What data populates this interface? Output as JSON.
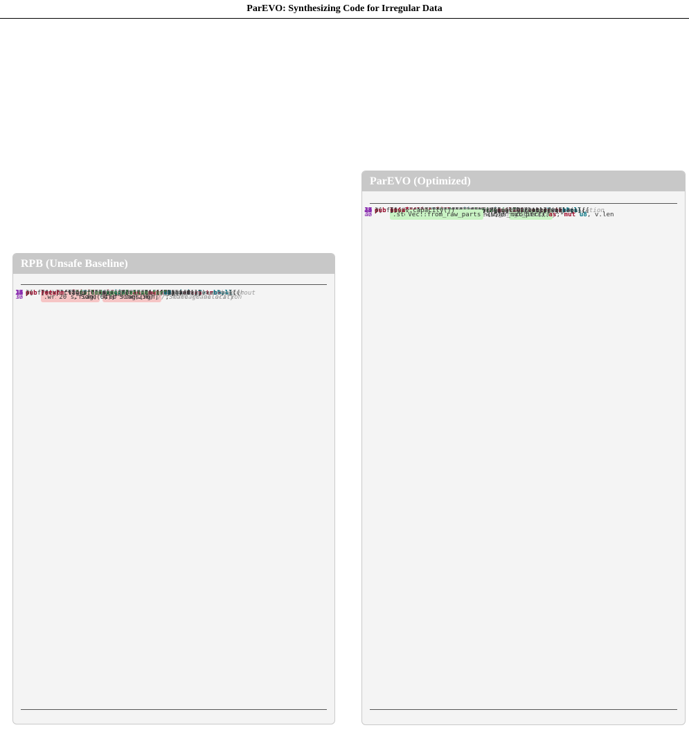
{
  "header": {
    "title": "ParEVO: Synthesizing Code for Irregular Data"
  },
  "panels": {
    "left": {
      "title": "RPB (Unsafe Baseline)",
      "lines": [
        {
          "n": "1",
          "h": "#[cfg(not(feature = <span class='s'>\"openevolve\"</span>))]"
        },
        {
          "n": "2",
          "h": "<span class='k'>pub fn</span> maximal_independent_set(g: &amp;Graph) -&gt; <span class='t'>Vec</span>&lt;<span class='t'>u8</span>&gt; {"
        },
        {
          "n": "3",
          "h": "    <span class='k'>let</span> n = g.n;"
        },
        {
          "n": "4",
          "h": "    <span class='c'>// UNSAFE: Standard Vec used for concurrent access</span>"
        },
        {
          "n": "5",
          "h": "    <span class='k'>let</span> flags: <span class='t'>Vec</span>&lt;<span class='t'>u8</span>&gt; = (0..n).into_par_iter()"
        },
        {
          "n": "6",
          "hl": true,
          "h": "        .map(|_| 0) <span class='box red'>.collect()</span> ; <span class='c'>// Standard allocation</span>"
        },
        {
          "n": "7",
          "h": "    <span class='k'>let</span> flags_ptr = flags.as_ptr() <span class='k'>as</span> <span class='t'>usize</span>;"
        },
        {
          "n": "8",
          "h": ""
        },
        {
          "n": "9",
          "h": "    <span class='k'>let</span> reserve = |i: <span class='t'>usize</span>, s: &amp;<span class='k'>mut</span> MISState| -&gt; <span class='t'>bool</span> {"
        },
        {
          "n": "10",
          "h": "        s.flag = 1;"
        },
        {
          "n": "11",
          "h": "        <span class='k'>let</span> v = g.index(i);"
        },
        {
          "n": "12",
          "h": "        <span class='k'>for</span> j <span class='k'>in</span> 0..v.degree {"
        },
        {
          "n": "13",
          "h": "            <span class='k'>let</span> ngh = v.neighbors[j] <span class='k'>as</span> <span class='t'>usize</span>;"
        },
        {
          "n": "14",
          "h": "            <span class='k'>if</span> ngh &lt; i {"
        },
        {
          "n": "15",
          "h": "                <span class='c'>// DATA RACE: Reading mutable memory without</span>"
        },
        {
          "n": "",
          "ind": true,
          "h": "<span class='c'>atomics</span>"
        },
        {
          "n": "16",
          "h": "                <span class='c'>// Compiler may optimize incorrectly;</span>"
        },
        {
          "n": "",
          "ind": true,
          "h": "<span class='c'>Undefined Behavior</span>"
        },
        {
          "n": "17",
          "hl": true,
          "h": "                <span class='k'>let</span> f = <span class='box red'>flags[ngh]</span> ;"
        },
        {
          "n": "18",
          "h": "                <span class='k'>if</span> f == 1 { s.flag = 2; <span class='k'>return true</span>; }"
        },
        {
          "n": "19",
          "h": "                <span class='k'>else if</span> f == 0 { s.flag = 0; }"
        },
        {
          "n": "20",
          "h": "            }"
        },
        {
          "n": "21",
          "h": "        }"
        },
        {
          "n": "22",
          "h": "        <span class='k'>true</span>"
        },
        {
          "n": "23",
          "h": "    };"
        },
        {
          "n": "24",
          "h": ""
        },
        {
          "n": "25",
          "h": "    <span class='k'>let</span> commit = |i: <span class='t'>usize</span>, s: &amp;<span class='k'>mut</span> MISState| -&gt; <span class='t'>bool</span> {"
        },
        {
          "n": "26",
          "h": "        <span class='c'>// UNSAFE POINTER WRITE: Bypassing borrow checker</span>"
        },
        {
          "n": "27",
          "h": "        <span class='k'>unsafe</span> { (flags_ptr <span class='k'>as</span> *<span class='k'>mut</span> <span class='t'>u8</span>).add(i)"
        },
        {
          "n": "",
          "ind": true,
          "hl": true,
          "h": "<span class='box red'>.write(s.flag)</span> ; }"
        },
        {
          "n": "28",
          "h": "        s.flag &gt; 0"
        },
        {
          "n": "29",
          "h": "    };"
        },
        {
          "n": "30",
          "h": ""
        },
        {
          "n": "31",
          "h": "    (0..n).stateful_spec_for("
        },
        {
          "n": "32",
          "h": "        reserve, commit, MISState { flag: 0 },"
        },
        {
          "n": "33",
          "hl": true,
          "h": "        <span class='box red'>20</span> , Some(64), Some(256) <span class='c'>// Small granularity</span>"
        },
        {
          "n": "34",
          "h": "    ).expect(<span class='s'>\"failed speculative for\"</span>);"
        },
        {
          "n": "35",
          "h": ""
        },
        {
          "n": "36",
          "h": "    <span class='k'>return</span> flags;"
        },
        {
          "n": "37",
          "h": "}"
        },
        {
          "n": "38",
          "h": ""
        }
      ]
    },
    "right": {
      "title": "ParEVO (Optimized)",
      "lines": [
        {
          "n": "1",
          "h": "#[cfg(feature = <span class='s'>\"openevolve\"</span>)]"
        },
        {
          "n": "2",
          "h": "<span class='k'>pub fn</span> maximal_independent_set(g: &amp;Graph) -&gt; <span class='t'>Vec</span>&lt;<span class='t'>u8</span>&gt; {"
        },
        {
          "n": "3",
          "h": "    <span class='k'>let</span> n = g.n;"
        },
        {
          "n": "4",
          "h": "    <span class='c'>// PARALLEL ATOMICS: Safe concurrent access</span>"
        },
        {
          "n": "5",
          "h": "    <span class='k'>let</span> flags: <span class='t'>Vec</span>&lt;AtomicU8&gt; = (0..n).into_par_iter()"
        },
        {
          "n": "6",
          "hl": true,
          "h": "        .map(|_| AtomicU8::new(0)) <span class='box grn'>.collect()</span> ;"
        },
        {
          "n": "7",
          "h": "    <span class='k'>let</span> flags_slice = &amp;flags[..];"
        },
        {
          "n": "8",
          "h": ""
        },
        {
          "n": "9",
          "h": "    <span class='k'>let</span> reserve = |i: <span class='t'>usize</span>, s: &amp;<span class='k'>mut</span> MISState| -&gt; <span class='t'>bool</span> {"
        },
        {
          "n": "10",
          "h": "        <span class='k'>let</span> v = g.index(i);"
        },
        {
          "n": "11",
          "h": "        <span class='k'>let mut</span> waiting = <span class='k'>false</span>;"
        },
        {
          "n": "12",
          "h": "        <span class='k'>for</span> &amp;ngh <span class='k'>in</span> v.neighbors {"
        },
        {
          "n": "13",
          "h": "            <span class='k'>let</span> ngh = ngh <span class='k'>as</span> <span class='t'>usize</span>;"
        },
        {
          "n": "14",
          "h": "            <span class='k'>if</span> ngh &lt; i {"
        },
        {
          "n": "15",
          "h": "                <span class='c'>// SAFE ATOMIC LOAD: Correct synchronization</span>"
        },
        {
          "n": "16",
          "h": "                <span class='k'>let</span> f = <span class='k'>unsafe</span> {"
        },
        {
          "n": "17",
          "h": "                    flags_slice.get_unchecked(ngh)"
        },
        {
          "n": "",
          "ind": true,
          "hl": true,
          "h": "<span class='box grn'>.load(Relaxed)</span>"
        },
        {
          "n": "18",
          "h": "                };"
        },
        {
          "n": "19",
          "h": "                <span class='k'>if</span> f == 1 { s.flag = 2; <span class='k'>return true</span>; }"
        },
        {
          "n": "20",
          "h": "                <span class='k'>if</span> f == 0 { waiting = <span class='k'>true</span>; }"
        },
        {
          "n": "21",
          "h": "            }"
        },
        {
          "n": "22",
          "h": "        }"
        },
        {
          "n": "23",
          "h": "        s.flag = <span class='k'>if</span> waiting { 0 } <span class='k'>else</span> { 1 };"
        },
        {
          "n": "24",
          "h": "        <span class='k'>true</span>"
        },
        {
          "n": "25",
          "h": "    };"
        },
        {
          "n": "26",
          "h": ""
        },
        {
          "n": "27",
          "h": "    <span class='k'>let</span> commit = |i: <span class='t'>usize</span>, s: &amp;<span class='k'>mut</span> MISState| -&gt; <span class='t'>bool</span> {"
        },
        {
          "n": "28",
          "h": "        <span class='k'>if</span> s.flag &gt; 0 {"
        },
        {
          "n": "29",
          "h": "            <span class='c'>// SAFE ATOMIC STORE</span>"
        },
        {
          "n": "30",
          "h": "            <span class='k'>unsafe</span> { flags_slice.get_unchecked(i)"
        },
        {
          "n": "",
          "ind": true,
          "hl": true,
          "h": "<span class='box grn'>.store(s.flag, Relaxed)</span> ; }"
        },
        {
          "n": "31",
          "h": "            <span class='k'>true</span>"
        },
        {
          "n": "32",
          "h": "        } <span class='k'>else</span> { <span class='k'>false</span> }"
        },
        {
          "n": "33",
          "h": "    };"
        },
        {
          "n": "34",
          "h": ""
        },
        {
          "n": "35",
          "h": "    (0..n).stateful_spec_for("
        },
        {
          "n": "36",
          "h": "        reserve, commit, MISState { flag: 0 },"
        },
        {
          "n": "37",
          "hl": true,
          "h": "        <span class='box grn'>256</span> , None, None <span class='c'>// Larger granularity</span>"
        },
        {
          "n": "38",
          "h": "    ).expect(<span class='s'>\"failed speculative for\"</span>);"
        },
        {
          "n": "39",
          "h": ""
        },
        {
          "n": "40",
          "h": "    <span class='c'>// ZERO-COPY TRANSFORMATION: AtomicU8 -&gt; u8</span>"
        },
        {
          "n": "41",
          "h": "    <span class='k'>unsafe</span> {"
        },
        {
          "n": "42",
          "h": "        <span class='k'>let mut</span> v = std::mem::ManuallyDrop::new(flags);"
        },
        {
          "n": "43",
          "hl": true,
          "h": "        <span class='box grn'>Vec::from_raw_parts</span> (v.as_mut_ptr() <span class='k'>as</span> *<span class='k'>mut</span> <span class='t'>u8</span>, v.len"
        },
        {
          "n": "",
          "ind": true,
          "h": "(), v.capacity())"
        },
        {
          "n": "44",
          "h": "    }"
        },
        {
          "n": "45",
          "h": "}"
        },
        {
          "n": "46",
          "h": ""
        }
      ]
    }
  }
}
